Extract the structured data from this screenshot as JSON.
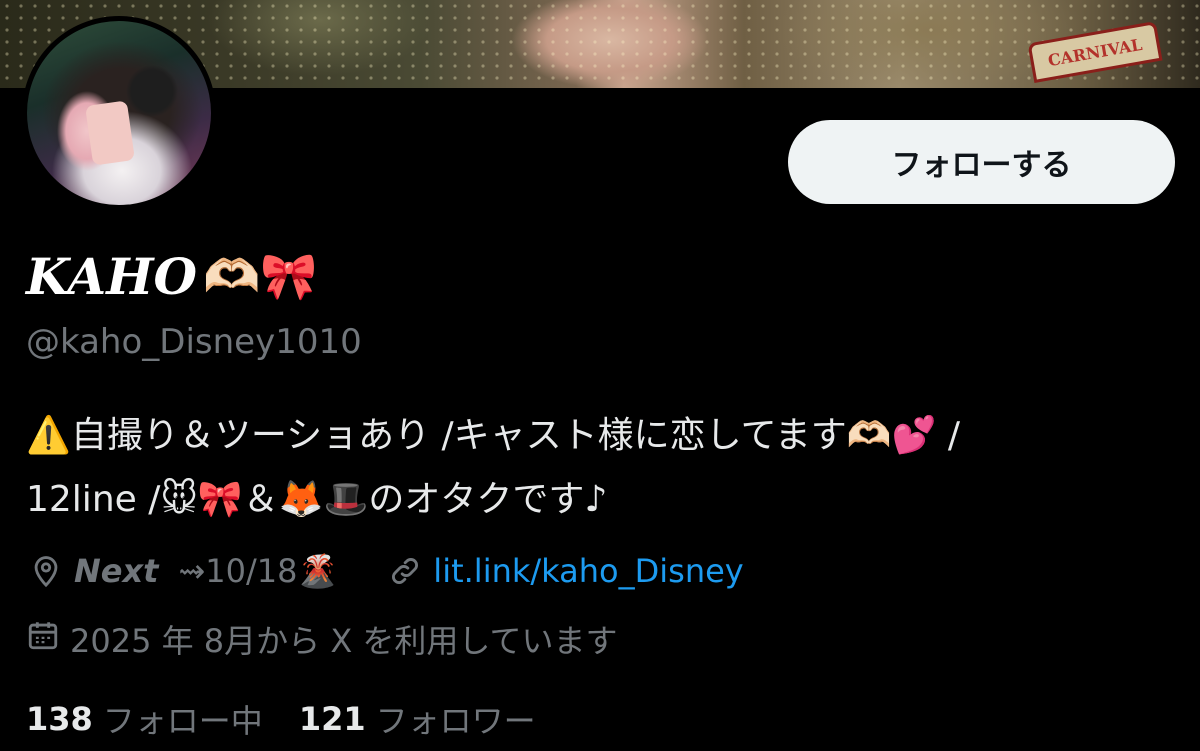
{
  "profile": {
    "follow_button": "フォローする",
    "display_name": "KAHO",
    "display_name_emoji": "🫶🏻🎀",
    "handle": "@kaho_Disney1010",
    "bio_line1": "⚠️自撮り＆ツーショあり /キャスト様に恋してます🫶🏻💕 /",
    "bio_line2": "12line /🐭🎀＆🦊🎩のオタクです♪",
    "location_bold": "Next",
    "location_rest": "⇝10/18🌋",
    "website": "lit.link/kaho_Disney",
    "joined": "2025 年 8月から X を利用しています",
    "following_count": "138",
    "following_label": "フォロー中",
    "followers_count": "121",
    "followers_label": "フォロワー"
  },
  "banner": {
    "sign_text": "CARNIVAL"
  },
  "icons": {
    "location": "location-pin-icon",
    "link": "link-icon",
    "calendar": "calendar-icon"
  },
  "colors": {
    "background": "#000000",
    "primary_text": "#e7e9ea",
    "secondary_text": "#71767b",
    "link": "#1d9bf0",
    "button_bg": "#eff3f4",
    "button_text": "#0f1419"
  }
}
